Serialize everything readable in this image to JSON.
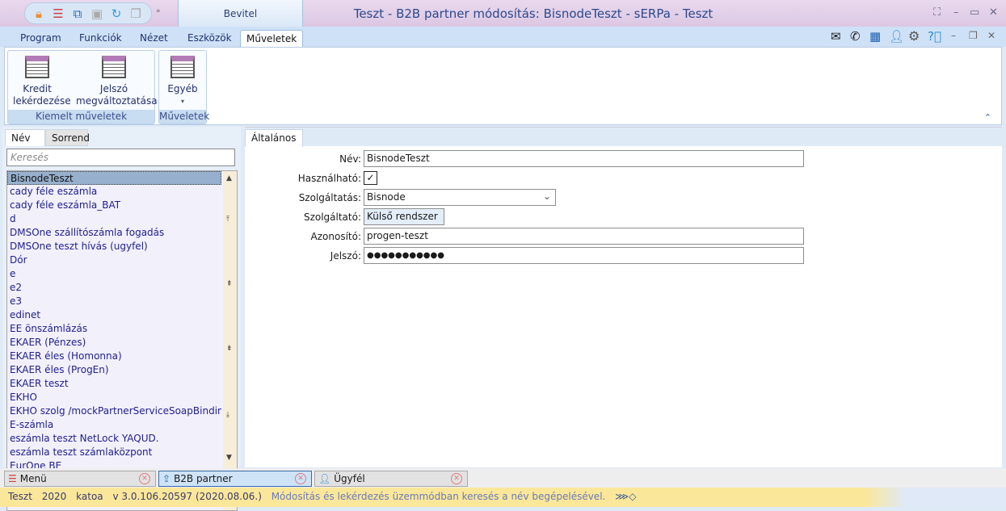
{
  "window": {
    "title": "Teszt - B2B partner módosítás: BisnodeTeszt - sERPa - Teszt",
    "context_tab": "Bevitel"
  },
  "ribbon": {
    "tabs": [
      "Program",
      "Funkciók",
      "Nézet",
      "Eszközök",
      "Műveletek"
    ],
    "active_tab": "Műveletek",
    "groups": [
      {
        "label": "Kiemelt műveletek",
        "buttons": [
          {
            "line1": "Kredit",
            "line2": "lekérdezése"
          },
          {
            "line1": "Jelszó",
            "line2": "megváltoztatása"
          }
        ]
      },
      {
        "label": "Műveletek",
        "buttons": [
          {
            "line1": "Egyéb",
            "line2": "▾"
          }
        ]
      }
    ]
  },
  "left": {
    "tabs": [
      "Név",
      "Sorrend"
    ],
    "search_placeholder": "Keresés",
    "items": [
      "BisnodeTeszt",
      "cady féle eszámla",
      "cady féle eszámla_BAT",
      "d",
      "DMSOne szállítószámla fogadás",
      "DMSOne teszt hívás (ugyfel)",
      "Dór",
      "e",
      "e2",
      "e3",
      "edinet",
      "EE önszámlázás",
      "EKAER (Pénzes)",
      "EKAER éles (Homonna)",
      "EKAER éles (ProgEn)",
      "EKAER teszt",
      "EKHO",
      "EKHO szolg /mockPartnerServiceSoapBinding",
      "E-számla",
      "eszámla teszt NetLock YAQUD.",
      "eszámla teszt számlaközpont",
      "EurOne BE"
    ]
  },
  "form": {
    "tab": "Általános",
    "nev_label": "Név:",
    "nev": "BisnodeTeszt",
    "hasznalhato_label": "Használható:",
    "hasznalhato": "✓",
    "szolgaltatas_label": "Szolgáltatás:",
    "szolgaltatas": "Bisnode",
    "szolgaltato_label": "Szolgáltató:",
    "szolgaltato": "Külső rendszer",
    "azonosito_label": "Azonosító:",
    "azonosito": "progen-teszt",
    "jelszo_label": "Jelszó:",
    "jelszo": "●●●●●●●●●●●"
  },
  "bottom_tabs": [
    "Menü",
    "B2B partner",
    "Ügyfél"
  ],
  "status": {
    "env": "Teszt",
    "year": "2020",
    "user": "katoa",
    "version": "v 3.0.106.20597 (2020.08.06.)",
    "message": "Módosítás és lekérdezés üzemmódban keresés a név begépelésével."
  }
}
